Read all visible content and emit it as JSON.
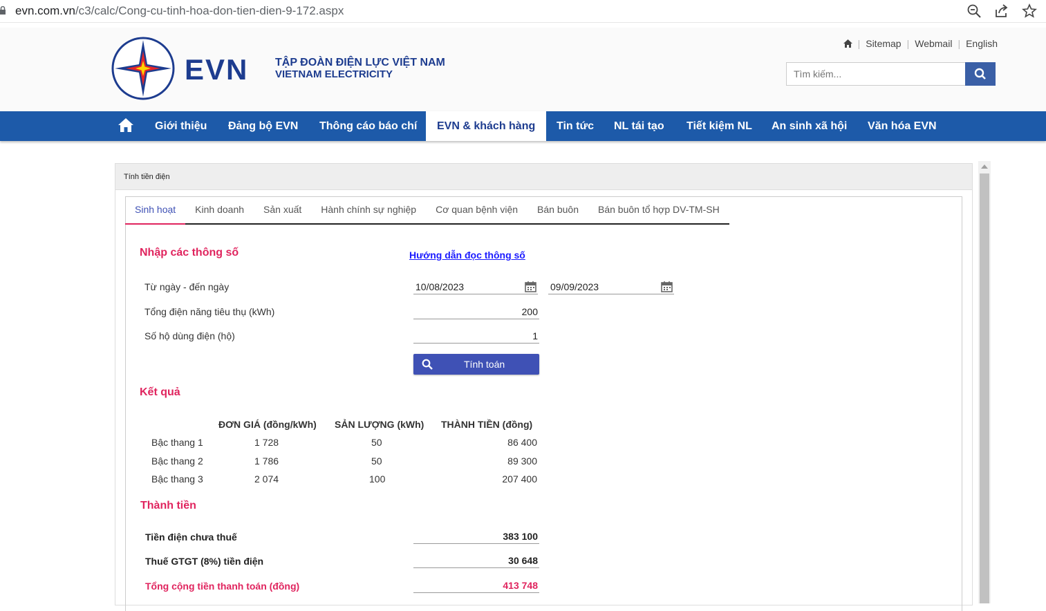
{
  "browser": {
    "url_host": "evn.com.vn",
    "url_path": "/c3/calc/Cong-cu-tinh-hoa-don-tien-dien-9-172.aspx"
  },
  "header": {
    "logo_text": "EVN",
    "org_name_vn": "TẬP ĐOÀN ĐIỆN LỰC VIỆT NAM",
    "org_name_en": "VIETNAM ELECTRICITY",
    "links": [
      "Sitemap",
      "Webmail",
      "English"
    ],
    "search_placeholder": "Tìm kiếm..."
  },
  "nav": {
    "items": [
      "Giới thiệu",
      "Đảng bộ EVN",
      "Thông cáo báo chí",
      "EVN & khách hàng",
      "Tin tức",
      "NL tái tạo",
      "Tiết kiệm NL",
      "An sinh xã hội",
      "Văn hóa EVN"
    ],
    "active": "EVN & khách hàng"
  },
  "panel": {
    "title": "Tính tiền điện",
    "tabs": [
      "Sinh hoạt",
      "Kinh doanh",
      "Sản xuất",
      "Hành chính sự nghiệp",
      "Cơ quan bệnh viện",
      "Bán buôn",
      "Bán buôn tổ hợp DV-TM-SH"
    ],
    "active_tab": "Sinh hoạt"
  },
  "inputs": {
    "section_title": "Nhập các thông số",
    "guide_link": "Hướng dẫn đọc thông số",
    "date_label": "Từ ngày - đến ngày",
    "from_date": "10/08/2023",
    "to_date": "09/09/2023",
    "kwh_label": "Tổng điện năng tiêu thụ (kWh)",
    "kwh_value": "200",
    "households_label": "Số hộ dùng điện (hộ)",
    "households_value": "1",
    "calc_button": "Tính toán"
  },
  "results": {
    "section_title": "Kết quả",
    "headers": [
      "ĐƠN GIÁ (đồng/kWh)",
      "SẢN LƯỢNG (kWh)",
      "THÀNH TIỀN (đồng)"
    ],
    "rows": [
      {
        "tier": "Bậc thang 1",
        "price": "1 728",
        "qty": "50",
        "amount": "86 400"
      },
      {
        "tier": "Bậc thang 2",
        "price": "1 786",
        "qty": "50",
        "amount": "89 300"
      },
      {
        "tier": "Bậc thang 3",
        "price": "2 074",
        "qty": "100",
        "amount": "207 400"
      }
    ]
  },
  "totals": {
    "section_title": "Thành tiền",
    "pre_tax_label": "Tiền điện chưa thuế",
    "pre_tax_value": "383 100",
    "vat_label": "Thuế GTGT (8%) tiền điện",
    "vat_value": "30 648",
    "total_label": "Tổng cộng tiền thanh toán (đồng)",
    "total_value": "413 748"
  },
  "colors": {
    "nav_bg": "#1d5aa9",
    "accent_pink": "#e0245e",
    "button": "#3f51b5",
    "brand": "#1d3c8f"
  }
}
